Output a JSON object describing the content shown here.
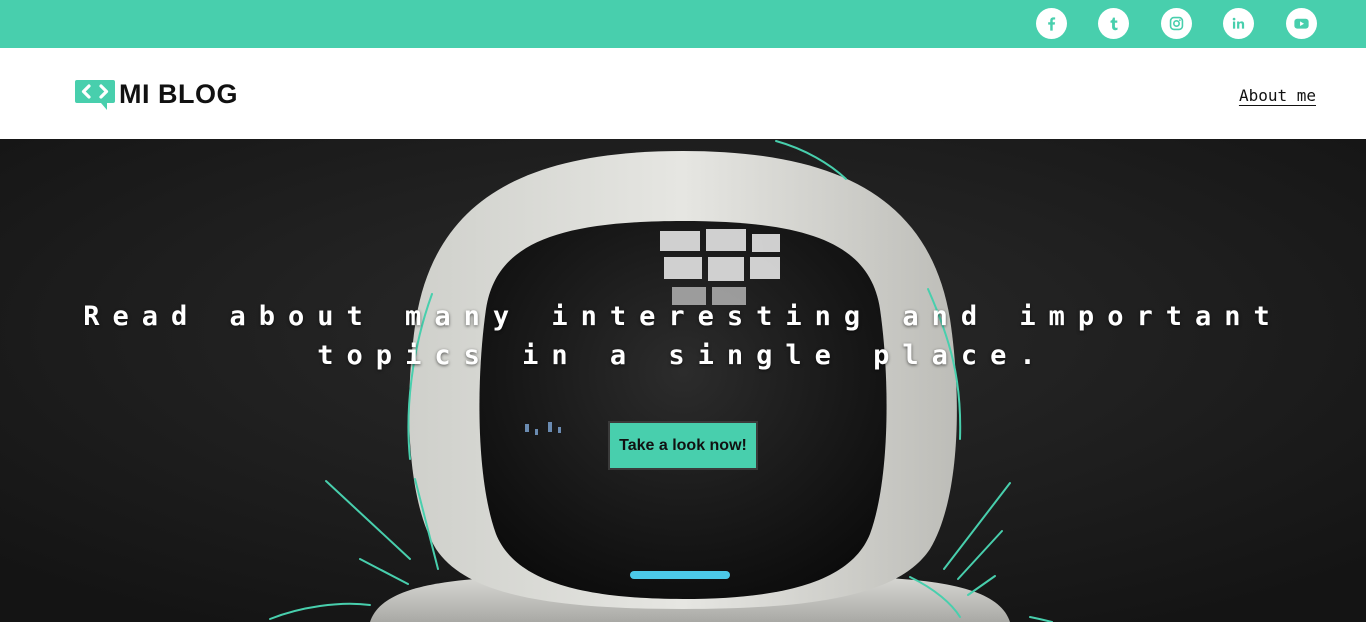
{
  "colors": {
    "accent": "#48cfad",
    "text_dark": "#111111",
    "hero_bg": "#1f1f1f"
  },
  "social": [
    {
      "icon": "facebook-icon"
    },
    {
      "icon": "tumblr-icon"
    },
    {
      "icon": "instagram-icon"
    },
    {
      "icon": "linkedin-icon"
    },
    {
      "icon": "youtube-icon"
    }
  ],
  "header": {
    "logo_text": "MI BLOG",
    "logo_icon": "code-brackets-chat-icon",
    "nav": {
      "about_label": "About me"
    }
  },
  "hero": {
    "background": "robot-helmet-photo",
    "title": "Read about many interesting and important topics in a single place.",
    "cta_label": "Take a look now!"
  }
}
